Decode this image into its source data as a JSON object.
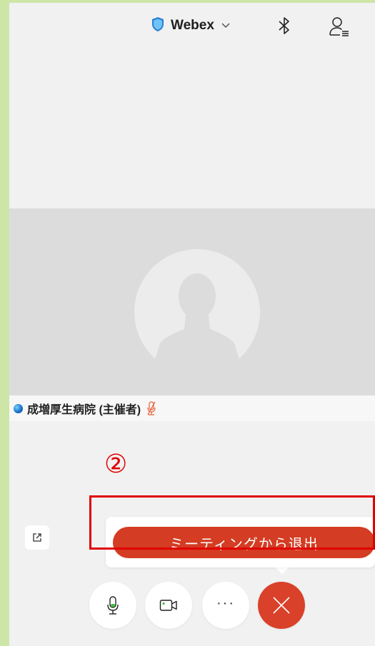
{
  "header": {
    "app_name": "Webex",
    "icons": {
      "brand": "webex-shield-icon",
      "bluetooth": "bluetooth-icon",
      "participants": "participants-icon"
    }
  },
  "participant": {
    "name": "成増厚生病院 (主催者)",
    "muted": true
  },
  "annotation": {
    "step_number": "②",
    "color": "#e00000"
  },
  "popover": {
    "leave_label": "ミーティングから退出"
  },
  "controls": {
    "more_label": "···",
    "icons": [
      "microphone-icon",
      "video-camera-icon",
      "more-options-icon",
      "end-call-icon"
    ]
  },
  "colors": {
    "leave_button": "#d43c23",
    "end_call": "#d9412a",
    "accent_blue": "#1a73c9"
  }
}
